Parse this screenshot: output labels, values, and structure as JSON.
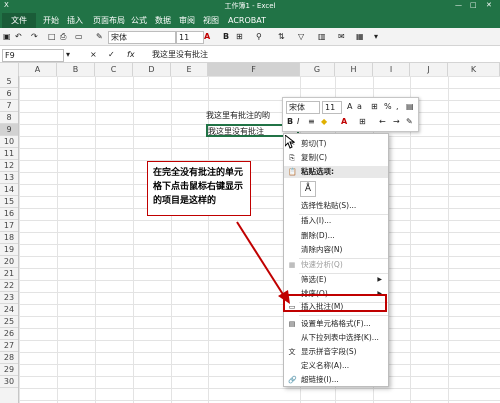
{
  "window": {
    "title": "工作簿1 - Excel"
  },
  "ribbon": {
    "tabs": [
      "文件",
      "开始",
      "插入",
      "页面布局",
      "公式",
      "数据",
      "审阅",
      "视图",
      "ACROBAT"
    ]
  },
  "toolbar": {
    "font": "宋体",
    "size": "11",
    "bold": "B"
  },
  "formula_bar": {
    "name_box": "F9",
    "cancel": "×",
    "enter": "✓",
    "fx": "fx",
    "content": "我这里没有批注"
  },
  "columns": [
    "A",
    "B",
    "C",
    "D",
    "E",
    "F",
    "G",
    "H",
    "I",
    "J",
    "K"
  ],
  "rows": [
    "5",
    "6",
    "7",
    "8",
    "9",
    "10",
    "11",
    "12",
    "13",
    "14",
    "15",
    "16",
    "17",
    "18",
    "19",
    "20",
    "21",
    "22",
    "23",
    "24",
    "25",
    "26",
    "27",
    "28",
    "29",
    "30"
  ],
  "cells": {
    "f7": "我这里有批注的哟",
    "f9": "我这里没有批注"
  },
  "mini_toolbar": {
    "font": "宋体",
    "size": "11",
    "bold": "B",
    "italic": "I",
    "percent": "%",
    "comma": ","
  },
  "context_menu": {
    "items": [
      {
        "icon": "✂",
        "label": "剪切(T)"
      },
      {
        "icon": "⎘",
        "label": "复制(C)"
      },
      {
        "icon": "📋",
        "label": "粘贴选项:"
      },
      {
        "icon": "",
        "label": "选择性粘贴(S)..."
      },
      {
        "icon": "",
        "label": "插入(I)..."
      },
      {
        "icon": "",
        "label": "删除(D)..."
      },
      {
        "icon": "",
        "label": "清除内容(N)"
      },
      {
        "icon": "▦",
        "label": "快速分析(Q)"
      },
      {
        "icon": "",
        "label": "筛选(E)"
      },
      {
        "icon": "",
        "label": "排序(O)"
      },
      {
        "icon": "▭",
        "label": "插入批注(M)"
      },
      {
        "icon": "▤",
        "label": "设置单元格格式(F)..."
      },
      {
        "icon": "",
        "label": "从下拉列表中选择(K)..."
      },
      {
        "icon": "文",
        "label": "显示拼音字段(S)"
      },
      {
        "icon": "",
        "label": "定义名称(A)..."
      },
      {
        "icon": "🔗",
        "label": "超链接(I)..."
      }
    ]
  },
  "annotation": {
    "text": "在完全没有批注的单元格下点击鼠标右键显示的项目是这样的"
  },
  "colors": {
    "excel_green": "#217346",
    "annotation_red": "#c00000"
  }
}
